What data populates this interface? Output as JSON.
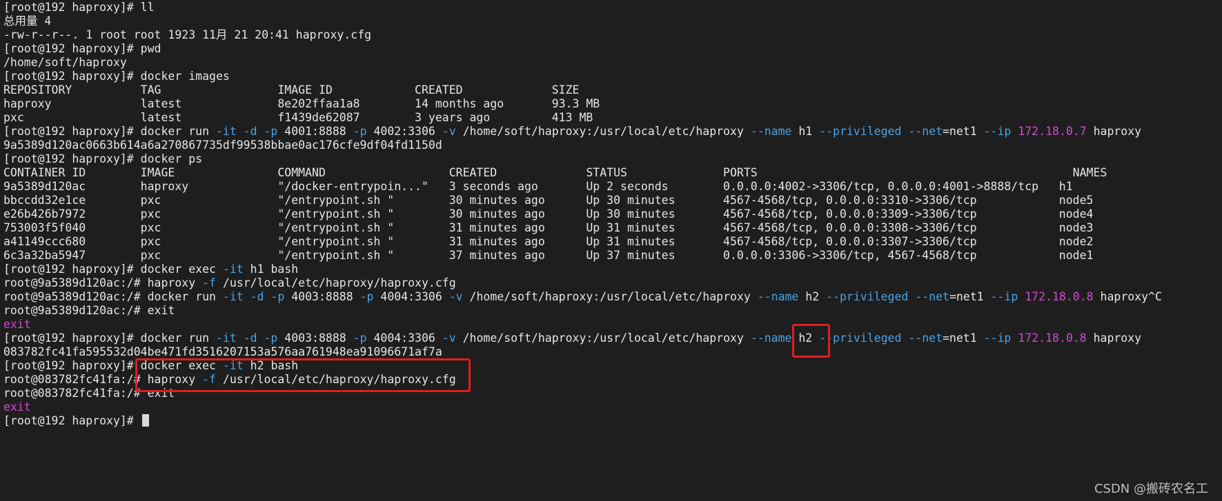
{
  "terminal": {
    "lines": [
      [
        {
          "text": "[root@192 haproxy]# ll",
          "c": "n"
        }
      ],
      [
        {
          "text": "总用量 4",
          "c": "n"
        }
      ],
      [
        {
          "text": "-rw-r--r--. 1 root root 1923 11月 21 20:41 haproxy.cfg",
          "c": "n"
        }
      ],
      [
        {
          "text": "[root@192 haproxy]# pwd",
          "c": "n"
        }
      ],
      [
        {
          "text": "/home/soft/haproxy",
          "c": "n"
        }
      ],
      [
        {
          "text": "[root@192 haproxy]# docker images",
          "c": "n"
        }
      ],
      [
        {
          "text": "REPOSITORY          TAG                 IMAGE ID            CREATED             SIZE",
          "c": "n"
        }
      ],
      [
        {
          "text": "haproxy             latest              8e202ffaa1a8        14 months ago       93.3 MB",
          "c": "n"
        }
      ],
      [
        {
          "text": "pxc                 latest              f1439de62087        3 years ago         413 MB",
          "c": "n"
        }
      ],
      [
        {
          "text": "[root@192 haproxy]# docker run ",
          "c": "n"
        },
        {
          "text": "-it -d -p",
          "c": "f"
        },
        {
          "text": " 4001:8888 ",
          "c": "n"
        },
        {
          "text": "-p",
          "c": "f"
        },
        {
          "text": " 4002:3306 ",
          "c": "n"
        },
        {
          "text": "-v",
          "c": "f"
        },
        {
          "text": " /home/soft/haproxy:/usr/local/etc/haproxy ",
          "c": "n"
        },
        {
          "text": "--name",
          "c": "f"
        },
        {
          "text": " h1 ",
          "c": "n"
        },
        {
          "text": "--privileged --net",
          "c": "f"
        },
        {
          "text": "=net1 ",
          "c": "n"
        },
        {
          "text": "--ip",
          "c": "f"
        },
        {
          "text": " ",
          "c": "n"
        },
        {
          "text": "172.18.0.7",
          "c": "i"
        },
        {
          "text": " haproxy",
          "c": "n"
        }
      ],
      [
        {
          "text": "9a5389d120ac0663b614a6a270867735df99538bbae0ac176cfe9df04fd1150d",
          "c": "n"
        }
      ],
      [
        {
          "text": "[root@192 haproxy]# docker ps",
          "c": "n"
        }
      ],
      [
        {
          "text": "CONTAINER ID        IMAGE               COMMAND                  CREATED             STATUS              PORTS                                              NAMES",
          "c": "n"
        }
      ],
      [
        {
          "text": "9a5389d120ac        haproxy             \"/docker-entrypoin...\"   3 seconds ago       Up 2 seconds        0.0.0.0:4002->3306/tcp, 0.0.0.0:4001->8888/tcp   h1",
          "c": "n"
        }
      ],
      [
        {
          "text": "bbccdd32e1ce        pxc                 \"/entrypoint.sh \"        30 minutes ago      Up 30 minutes       4567-4568/tcp, 0.0.0.0:3310->3306/tcp            node5",
          "c": "n"
        }
      ],
      [
        {
          "text": "e26b426b7972        pxc                 \"/entrypoint.sh \"        30 minutes ago      Up 30 minutes       4567-4568/tcp, 0.0.0.0:3309->3306/tcp            node4",
          "c": "n"
        }
      ],
      [
        {
          "text": "753003f5f040        pxc                 \"/entrypoint.sh \"        31 minutes ago      Up 31 minutes       4567-4568/tcp, 0.0.0.0:3308->3306/tcp            node3",
          "c": "n"
        }
      ],
      [
        {
          "text": "a41149ccc680        pxc                 \"/entrypoint.sh \"        31 minutes ago      Up 31 minutes       4567-4568/tcp, 0.0.0.0:3307->3306/tcp            node2",
          "c": "n"
        }
      ],
      [
        {
          "text": "6c3a32ba5947        pxc                 \"/entrypoint.sh \"        37 minutes ago      Up 37 minutes       0.0.0.0:3306->3306/tcp, 4567-4568/tcp            node1",
          "c": "n"
        }
      ],
      [
        {
          "text": "[root@192 haproxy]# docker exec ",
          "c": "n"
        },
        {
          "text": "-it",
          "c": "f"
        },
        {
          "text": " h1 bash",
          "c": "n"
        }
      ],
      [
        {
          "text": "root@9a5389d120ac:/# haproxy ",
          "c": "n"
        },
        {
          "text": "-f",
          "c": "f"
        },
        {
          "text": " /usr/local/etc/haproxy/haproxy.cfg",
          "c": "n"
        }
      ],
      [
        {
          "text": "root@9a5389d120ac:/# docker run ",
          "c": "n"
        },
        {
          "text": "-it -d -p",
          "c": "f"
        },
        {
          "text": " 4003:8888 ",
          "c": "n"
        },
        {
          "text": "-p",
          "c": "f"
        },
        {
          "text": " 4004:3306 ",
          "c": "n"
        },
        {
          "text": "-v",
          "c": "f"
        },
        {
          "text": " /home/soft/haproxy:/usr/local/etc/haproxy ",
          "c": "n"
        },
        {
          "text": "--name",
          "c": "f"
        },
        {
          "text": " h2 ",
          "c": "n"
        },
        {
          "text": "--privileged --net",
          "c": "f"
        },
        {
          "text": "=net1 ",
          "c": "n"
        },
        {
          "text": "--ip",
          "c": "f"
        },
        {
          "text": " ",
          "c": "n"
        },
        {
          "text": "172.18.0.8",
          "c": "i"
        },
        {
          "text": " haproxy^C",
          "c": "n"
        }
      ],
      [
        {
          "text": "root@9a5389d120ac:/# exit",
          "c": "n"
        }
      ],
      [
        {
          "text": "exit",
          "c": "e"
        }
      ],
      [
        {
          "text": "[root@192 haproxy]# docker run ",
          "c": "n"
        },
        {
          "text": "-it -d -p",
          "c": "f"
        },
        {
          "text": " 4003:8888 ",
          "c": "n"
        },
        {
          "text": "-p",
          "c": "f"
        },
        {
          "text": " 4004:3306 ",
          "c": "n"
        },
        {
          "text": "-v",
          "c": "f"
        },
        {
          "text": " /home/soft/haproxy:/usr/local/etc/haproxy ",
          "c": "n"
        },
        {
          "text": "--name",
          "c": "f"
        },
        {
          "text": " h2 ",
          "c": "n"
        },
        {
          "text": "--privileged --net",
          "c": "f"
        },
        {
          "text": "=net1 ",
          "c": "n"
        },
        {
          "text": "--ip",
          "c": "f"
        },
        {
          "text": " ",
          "c": "n"
        },
        {
          "text": "172.18.0.8",
          "c": "i"
        },
        {
          "text": " haproxy",
          "c": "n"
        }
      ],
      [
        {
          "text": "083782fc41fa595532d04be471fd3516207153a576aa761948ea91096671af7a",
          "c": "n"
        }
      ],
      [
        {
          "text": "[root@192 haproxy]# docker exec ",
          "c": "n"
        },
        {
          "text": "-it",
          "c": "f"
        },
        {
          "text": " h2 bash",
          "c": "n"
        }
      ],
      [
        {
          "text": "root@083782fc41fa:/# haproxy ",
          "c": "n"
        },
        {
          "text": "-f",
          "c": "f"
        },
        {
          "text": " /usr/local/etc/haproxy/haproxy.cfg",
          "c": "n"
        }
      ],
      [
        {
          "text": "root@083782fc41fa:/# exit",
          "c": "n"
        }
      ],
      [
        {
          "text": "exit",
          "c": "e"
        }
      ],
      [
        {
          "text": "[root@192 haproxy]# ",
          "c": "n"
        }
      ]
    ]
  },
  "watermark": "CSDN @搬砖农名工",
  "colors": {
    "background": "#1e1e1e",
    "text": "#e6e6e6",
    "flag": "#4aa3e6",
    "ip": "#d24bd2",
    "exit": "#d24bd2",
    "highlight_box": "#e31d1d"
  }
}
